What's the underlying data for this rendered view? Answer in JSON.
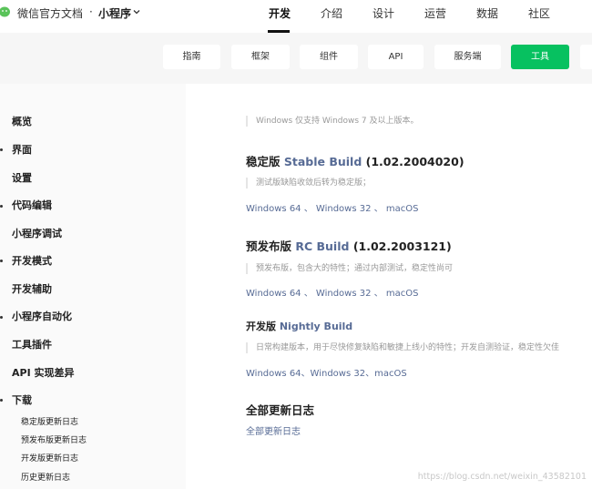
{
  "header": {
    "logo_text": "微信官方文档",
    "dot": "·",
    "product": "小程序",
    "nav": [
      {
        "label": "开发",
        "active": true
      },
      {
        "label": "介绍"
      },
      {
        "label": "设计"
      },
      {
        "label": "运营"
      },
      {
        "label": "数据"
      },
      {
        "label": "社区"
      }
    ]
  },
  "subnav": {
    "tabs": [
      {
        "label": "指南"
      },
      {
        "label": "框架"
      },
      {
        "label": "组件"
      },
      {
        "label": "API"
      },
      {
        "label": "服务端"
      },
      {
        "label": "工具",
        "active": true
      }
    ],
    "active_color": "#07c160"
  },
  "sidebar": {
    "items": [
      {
        "label": "概览"
      },
      {
        "label": "界面"
      },
      {
        "label": "设置"
      },
      {
        "label": "代码编辑"
      },
      {
        "label": "小程序调试"
      },
      {
        "label": "开发模式"
      },
      {
        "label": "开发辅助"
      },
      {
        "label": "小程序自动化"
      },
      {
        "label": "工具插件"
      },
      {
        "label": "API 实现差异"
      },
      {
        "label": "下载"
      }
    ],
    "subitems": [
      {
        "label": "稳定版更新日志"
      },
      {
        "label": "预发布版更新日志"
      },
      {
        "label": "开发版更新日志"
      },
      {
        "label": "历史更新日志"
      }
    ]
  },
  "main": {
    "top_note": "Windows 仅支持 Windows 7 及以上版本。",
    "stable": {
      "prefix": "稳定版 ",
      "name": "Stable Build",
      "version": " (1.02.2004020)",
      "note": "测试版缺陷收敛后转为稳定版；",
      "links": [
        "Windows 64",
        "Windows 32",
        "macOS"
      ],
      "sep": "、"
    },
    "rc": {
      "prefix": "预发布版 ",
      "name": "RC Build",
      "version": " (1.02.2003121)",
      "note": "预发布版，包含大的特性；通过内部测试，稳定性尚可",
      "links": [
        "Windows 64",
        "Windows 32",
        "macOS"
      ],
      "sep": "、"
    },
    "nightly": {
      "prefix": "开发版 ",
      "name": "Nightly Build",
      "note": "日常构建版本，用于尽快修复缺陷和敏捷上线小的特性；开发自测验证，稳定性欠佳",
      "links": [
        "Windows 64",
        "Windows 32",
        "macOS"
      ],
      "sep": "、"
    },
    "changelog": {
      "title": "全部更新日志",
      "link": "全部更新日志"
    }
  },
  "watermark": "https://blog.csdn.net/weixin_43582101",
  "link_color": "#576b95"
}
